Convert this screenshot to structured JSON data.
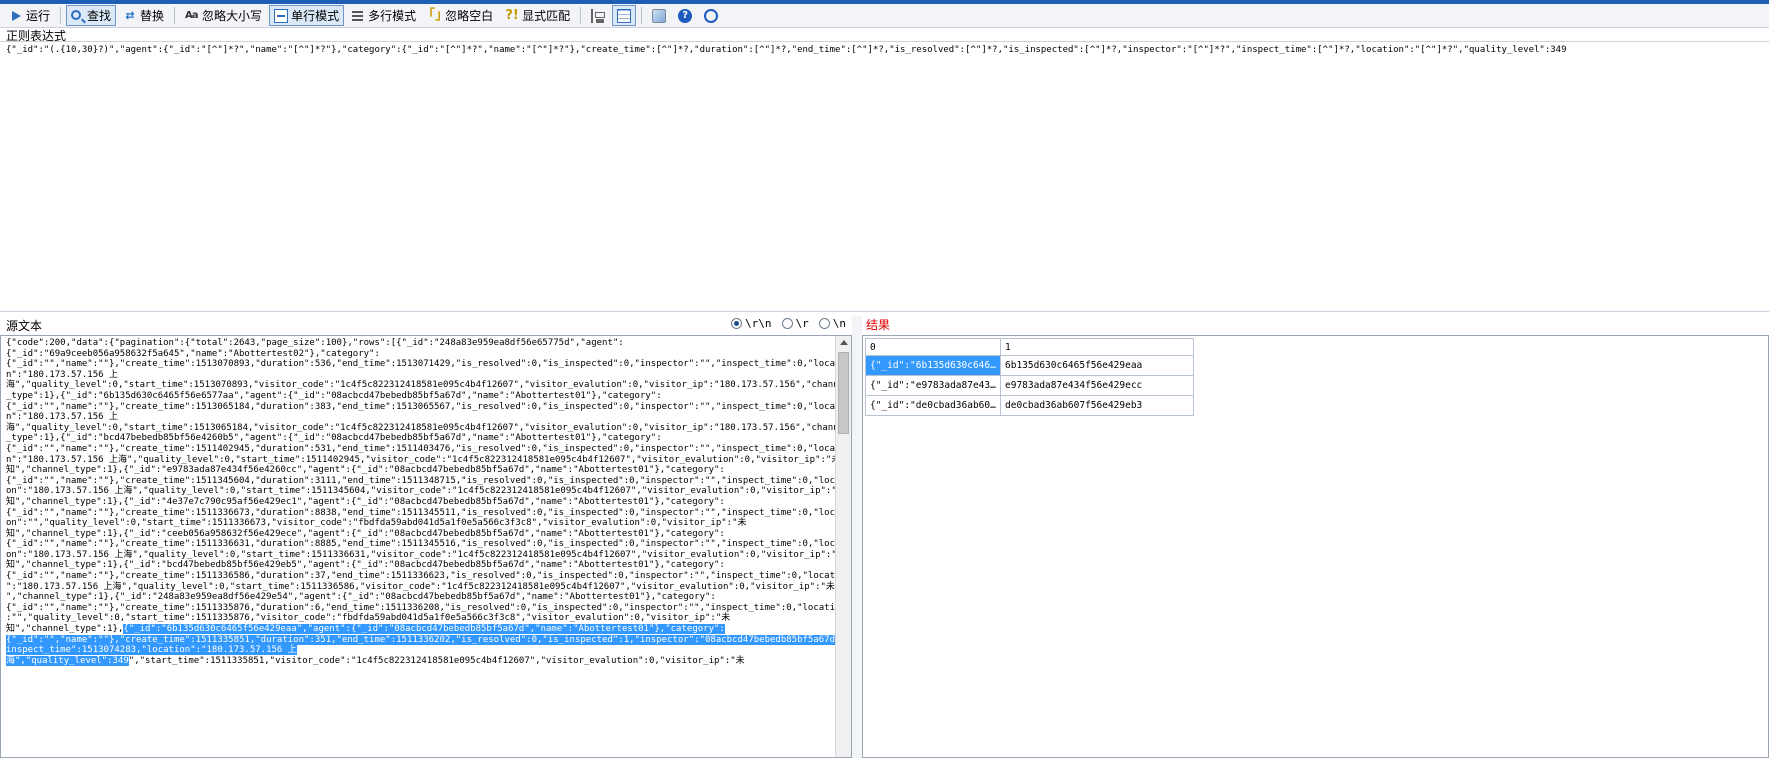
{
  "toolbar": {
    "run": "运行",
    "find": "查找",
    "replace": "替换",
    "ignore_case": "忽略大小写",
    "single_line": "单行模式",
    "multi_line": "多行模式",
    "ignore_whitespace": "忽略空白",
    "explicit_match": "显式匹配"
  },
  "regex": {
    "label": "正则表达式",
    "value": "{\"_id\":\"(.{10,30}?)\",\"agent\":{\"_id\":\"[^\"]*?\",\"name\":\"[^\"]*?\"},\"category\":{\"_id\":\"[^\"]*?\",\"name\":\"[^\"]*?\"},\"create_time\":[^\"]*?,\"duration\":[^\"]*?,\"end_time\":[^\"]*?,\"is_resolved\":[^\"]*?,\"is_inspected\":[^\"]*?,\"inspector\":\"[^\"]*?\",\"inspect_time\":[^\"]*?,\"location\":\"[^\"]*?\",\"quality_level\":349"
  },
  "source": {
    "label": "源文本",
    "newline_options": [
      "\\r\\n",
      "\\r",
      "\\n"
    ],
    "selected_newline": "\\r\\n",
    "lines": [
      {
        "t": "{\"code\":200,\"data\":{\"pagination\":{\"total\":2643,\"page_size\":100},\"rows\":[{\"_id\":\"248a83e959ea8df56e65775d\",\"agent\":"
      },
      {
        "t": "{\"_id\":\"69a9ceeb056a958632f5a645\",\"name\":\"Abottertest02\"},\"category\":"
      },
      {
        "t": "{\"_id\":\"\",\"name\":\"\"},\"create_time\":1513070893,\"duration\":536,\"end_time\":1513071429,\"is_resolved\":0,\"is_inspected\":0,\"inspector\":\"\",\"inspect_time\":0,\"locatio"
      },
      {
        "t": "n\":\"180.173.57.156 上"
      },
      {
        "t": "海\",\"quality_level\":0,\"start_time\":1513070893,\"visitor_code\":\"1c4f5c822312418581e095c4b4f12607\",\"visitor_evalution\":0,\"visitor_ip\":\"180.173.57.156\",\"channel"
      },
      {
        "t": "_type\":1},{\"_id\":\"6b135d630c6465f56e6577aa\",\"agent\":{\"_id\":\"08acbcd47bebedb85bf5a67d\",\"name\":\"Abottertest01\"},\"category\":"
      },
      {
        "t": "{\"_id\":\"\",\"name\":\"\"},\"create_time\":1513065184,\"duration\":383,\"end_time\":1513065567,\"is_resolved\":0,\"is_inspected\":0,\"inspector\":\"\",\"inspect_time\":0,\"locatio"
      },
      {
        "t": "n\":\"180.173.57.156 上"
      },
      {
        "t": "海\",\"quality_level\":0,\"start_time\":1513065184,\"visitor_code\":\"1c4f5c822312418581e095c4b4f12607\",\"visitor_evalution\":0,\"visitor_ip\":\"180.173.57.156\",\"channel"
      },
      {
        "t": "_type\":1},{\"_id\":\"bcd47bebedb85bf56e4260b5\",\"agent\":{\"_id\":\"08acbcd47bebedb85bf5a67d\",\"name\":\"Abottertest01\"},\"category\":"
      },
      {
        "t": "{\"_id\":\"\",\"name\":\"\"},\"create_time\":1511402945,\"duration\":531,\"end_time\":1511403476,\"is_resolved\":0,\"is_inspected\":0,\"inspector\":\"\",\"inspect_time\":0,\"locatio"
      },
      {
        "t": "n\":\"180.173.57.156 上海\",\"quality_level\":0,\"start_time\":1511402945,\"visitor_code\":\"1c4f5c822312418581e095c4b4f12607\",\"visitor_evalution\":0,\"visitor_ip\":\"未"
      },
      {
        "t": "知\",\"channel_type\":1},{\"_id\":\"e9783ada87e434f56e4260cc\",\"agent\":{\"_id\":\"08acbcd47bebedb85bf5a67d\",\"name\":\"Abottertest01\"},\"category\":"
      },
      {
        "t": "{\"_id\":\"\",\"name\":\"\"},\"create_time\":1511345604,\"duration\":3111,\"end_time\":1511348715,\"is_resolved\":0,\"is_inspected\":0,\"inspector\":\"\",\"inspect_time\":0,\"locati"
      },
      {
        "t": "on\":\"180.173.57.156 上海\",\"quality_level\":0,\"start_time\":1511345604,\"visitor_code\":\"1c4f5c822312418581e095c4b4f12607\",\"visitor_evalution\":0,\"visitor_ip\":\"未"
      },
      {
        "t": "知\",\"channel_type\":1},{\"_id\":\"4e37e7c790c95af56e429ec1\",\"agent\":{\"_id\":\"08acbcd47bebedb85bf5a67d\",\"name\":\"Abottertest01\"},\"category\":"
      },
      {
        "t": "{\"_id\":\"\",\"name\":\"\"},\"create_time\":1511336673,\"duration\":8838,\"end_time\":1511345511,\"is_resolved\":0,\"is_inspected\":0,\"inspector\":\"\",\"inspect_time\":0,\"locati"
      },
      {
        "t": "on\":\"\",\"quality_level\":0,\"start_time\":1511336673,\"visitor_code\":\"fbdfda59abd041d5a1f0e5a566c3f3c8\",\"visitor_evalution\":0,\"visitor_ip\":\"未"
      },
      {
        "t": "知\",\"channel_type\":1},{\"_id\":\"ceeb056a958632f56e429ece\",\"agent\":{\"_id\":\"08acbcd47bebedb85bf5a67d\",\"name\":\"Abottertest01\"},\"category\":"
      },
      {
        "t": "{\"_id\":\"\",\"name\":\"\"},\"create_time\":1511336631,\"duration\":8885,\"end_time\":1511345516,\"is_resolved\":0,\"is_inspected\":0,\"inspector\":\"\",\"inspect_time\":0,\"locati"
      },
      {
        "t": "on\":\"180.173.57.156 上海\",\"quality_level\":0,\"start_time\":1511336631,\"visitor_code\":\"1c4f5c822312418581e095c4b4f12607\",\"visitor_evalution\":0,\"visitor_ip\":\"未"
      },
      {
        "t": "知\",\"channel_type\":1},{\"_id\":\"bcd47bebedb85bf56e429eb5\",\"agent\":{\"_id\":\"08acbcd47bebedb85bf5a67d\",\"name\":\"Abottertest01\"},\"category\":"
      },
      {
        "t": "{\"_id\":\"\",\"name\":\"\"},\"create_time\":1511336586,\"duration\":37,\"end_time\":1511336623,\"is_resolved\":0,\"is_inspected\":0,\"inspector\":\"\",\"inspect_time\":0,\"location"
      },
      {
        "t": "\":\"180.173.57.156 上海\",\"quality_level\":0,\"start_time\":1511336586,\"visitor_code\":\"1c4f5c822312418581e095c4b4f12607\",\"visitor_evalution\":0,\"visitor_ip\":\"未知"
      },
      {
        "t": "\",\"channel_type\":1},{\"_id\":\"248a83e959ea8df56e429e54\",\"agent\":{\"_id\":\"08acbcd47bebedb85bf5a67d\",\"name\":\"Abottertest01\"},\"category\":"
      },
      {
        "t": "{\"_id\":\"\",\"name\":\"\"},\"create_time\":1511335876,\"duration\":6,\"end_time\":1511336208,\"is_resolved\":0,\"is_inspected\":0,\"inspector\":\"\",\"inspect_time\":0,\"location\""
      },
      {
        "t": ":\"\",\"quality_level\":0,\"start_time\":1511335876,\"visitor_code\":\"fbdfda59abd041d5a1f0e5a566c3f3c8\",\"visitor_evalution\":0,\"visitor_ip\":\"未"
      },
      {
        "t": "知\",\"channel_type\":1},",
        "h": "{\"_id\":\"6b135d630c6465f56e429eaa\",\"agent\":{\"_id\":\"08acbcd47bebedb85bf5a67d\",\"name\":\"Abottertest01\"},\"category\":"
      },
      {
        "t": "",
        "h": "{\"_id\":\"\",\"name\":\"\"},\"create_time\":1511335851,\"duration\":351,\"end_time\":1511336202,\"is_resolved\":0,\"is_inspected\":1,\"inspector\":\"08acbcd47bebedb85bf5a67d\",\""
      },
      {
        "t": "",
        "h": "inspect_time\":1513074283,\"location\":\"180.173.57.156 上"
      },
      {
        "t": "\",\"start_time\":1511335851,\"visitor_code\":\"1c4f5c822312418581e095c4b4f12607\",\"visitor_evalution\":0,\"visitor_ip\":\"未",
        "h": "海\",\"quality_level\":349",
        "hfirst": true
      }
    ]
  },
  "result": {
    "label": "结果",
    "columns": [
      "0",
      "1"
    ],
    "rows": [
      [
        "{\"_id\":\"6b135d630c646...",
        "6b135d630c6465f56e429eaa"
      ],
      [
        "{\"_id\":\"e9783ada87e43...",
        "e9783ada87e434f56e429ecc"
      ],
      [
        "{\"_id\":\"de0cbad36ab60...",
        "de0cbad36ab607f56e429eb3"
      ]
    ]
  }
}
